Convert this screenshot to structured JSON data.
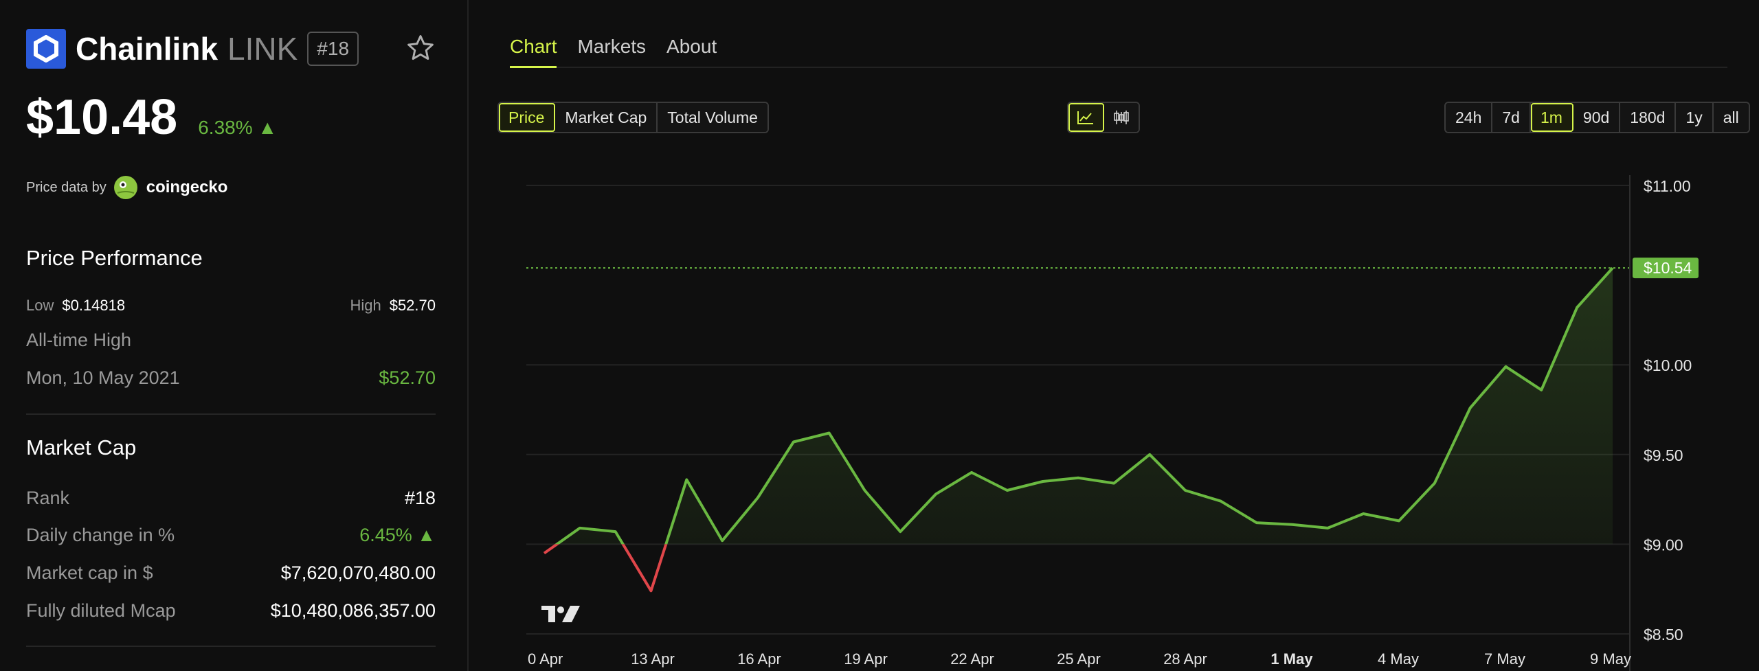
{
  "coin": {
    "name": "Chainlink",
    "ticker": "LINK",
    "rank_badge": "#18",
    "price": "$10.48",
    "change": "6.38% ▲",
    "price_data_by": "Price data by",
    "source": "coingecko"
  },
  "performance": {
    "title": "Price Performance",
    "low_label": "Low",
    "low_value": "$0.14818",
    "high_label": "High",
    "high_value": "$52.70",
    "ath_label": "All-time High",
    "ath_date": "Mon, 10 May 2021",
    "ath_value": "$52.70"
  },
  "market_cap": {
    "title": "Market Cap",
    "rows": [
      {
        "label": "Rank",
        "value": "#18"
      },
      {
        "label": "Daily change in %",
        "value": "6.45% ▲"
      },
      {
        "label": "Market cap in $",
        "value": "$7,620,070,480.00"
      },
      {
        "label": "Fully diluted Mcap",
        "value": "$10,480,086,357.00"
      }
    ]
  },
  "tabs": [
    "Chart",
    "Markets",
    "About"
  ],
  "metric_buttons": [
    "Price",
    "Market Cap",
    "Total Volume"
  ],
  "range_buttons": [
    "24h",
    "7d",
    "1m",
    "90d",
    "180d",
    "1y",
    "all"
  ],
  "icons": {
    "logo": "chainlink-hexagon-icon",
    "star": "star-icon",
    "source_logo": "coingecko-icon",
    "line_chart": "line-chart-icon",
    "candles": "candlestick-icon",
    "watermark": "tradingview-logo-icon"
  },
  "colors": {
    "accent": "#d6f44a",
    "up": "#6ab841",
    "down": "#e0464a",
    "brand": "#2a5ada"
  },
  "chart_data": {
    "type": "line",
    "x_tick_labels": [
      "0 Apr",
      "13 Apr",
      "16 Apr",
      "19 Apr",
      "22 Apr",
      "25 Apr",
      "28 Apr",
      "1 May",
      "4 May",
      "7 May",
      "9 May"
    ],
    "y_tick_labels": [
      "$11.00",
      "$10.00",
      "$9.50",
      "$9.00",
      "$8.50"
    ],
    "ylim": [
      8.5,
      11.0
    ],
    "current_price_label": "$10.54",
    "current_price": 10.54,
    "baseline": 9.0,
    "grid": "horizontal",
    "x": [
      0,
      1,
      2,
      3,
      4,
      5,
      6,
      7,
      8,
      9,
      10,
      11,
      12,
      13,
      14,
      15,
      16,
      17,
      18,
      19,
      20,
      21,
      22,
      23,
      24,
      25,
      26,
      27,
      28,
      29,
      30
    ],
    "values": [
      8.95,
      9.09,
      9.07,
      8.74,
      9.36,
      9.02,
      9.26,
      9.57,
      9.62,
      9.3,
      9.07,
      9.28,
      9.4,
      9.3,
      9.35,
      9.37,
      9.34,
      9.5,
      9.3,
      9.24,
      9.12,
      9.11,
      9.09,
      9.17,
      9.13,
      9.34,
      9.76,
      9.99,
      9.86,
      10.32,
      10.54
    ]
  }
}
